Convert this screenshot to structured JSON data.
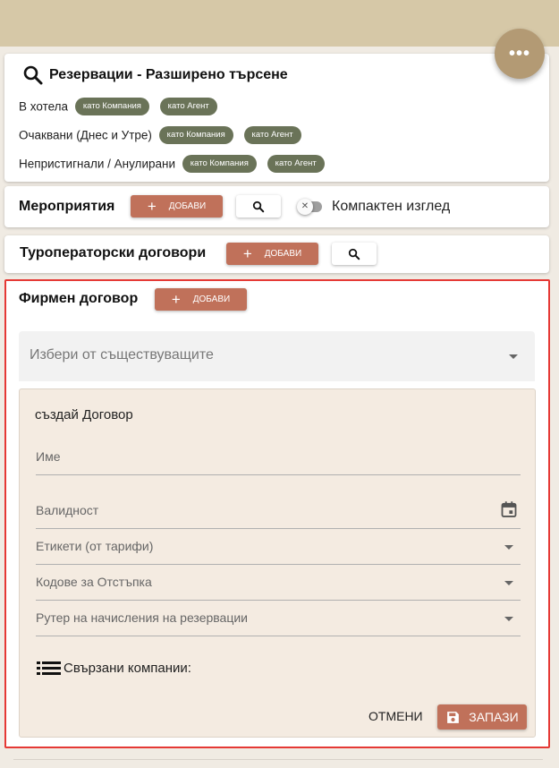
{
  "fab": {
    "icon": "more-horizontal-icon",
    "label": "•••"
  },
  "search_card": {
    "title": "Резервации - Разширено търсене",
    "rows": [
      {
        "label": "В хотела",
        "chips": [
          "като Компания",
          "като Агент"
        ]
      },
      {
        "label": "Очаквани (Днес и Утре)",
        "chips": [
          "като Компания",
          "като Агент"
        ]
      },
      {
        "label": "Непристигнали / Анулирани",
        "chips": [
          "като Компания",
          "като Агент"
        ]
      }
    ]
  },
  "events_card": {
    "title": "Мероприятия",
    "add_label": "ДОБАВИ",
    "compact_label": "Компактен изглед",
    "compact_enabled": false
  },
  "tour_card": {
    "title": "Туроператорски договори",
    "add_label": "ДОБАВИ"
  },
  "contract_card": {
    "title": "Фирмен договор",
    "add_label": "ДОБАВИ",
    "select_placeholder": "Избери от съществуващите",
    "form": {
      "heading": "създай Договор",
      "name_label": "Име",
      "validity_label": "Валидност",
      "tags_label": "Етикети (от тарифи)",
      "discount_codes_label": "Кодове за Отстъпка",
      "router_label": "Рутер на начисления на резервации",
      "linked_companies_label": "Свързани компании:",
      "cancel_label": "ОТМЕНИ",
      "save_label": "ЗАПАЗИ"
    }
  },
  "colors": {
    "topbar": "#d6c8a7",
    "fab": "#b39a74",
    "chip": "#6a7358",
    "primary_button": "#c0715a",
    "highlight_border": "#e53935",
    "form_background": "#f4ebe1"
  }
}
